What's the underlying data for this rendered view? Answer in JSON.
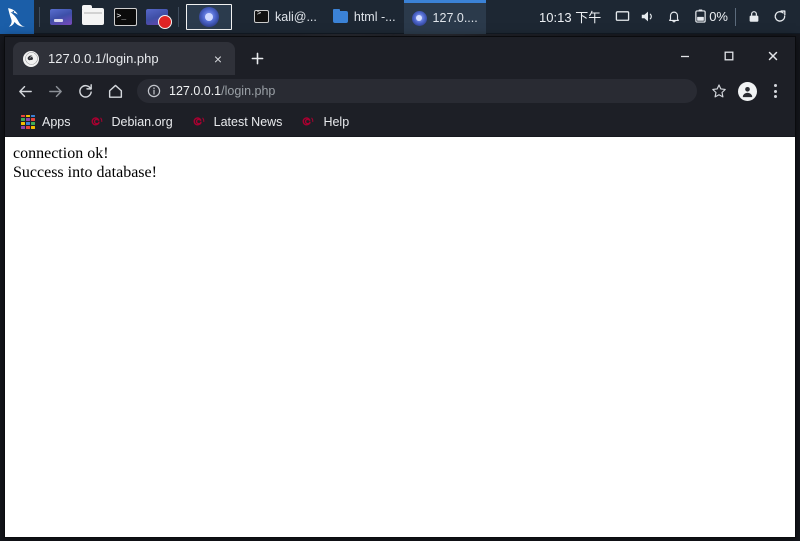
{
  "panel": {
    "logo_icon": "kali-dragon-icon",
    "launchers": [
      {
        "name": "app-launcher-window",
        "icon": "window-app-icon"
      },
      {
        "name": "app-launcher-files",
        "icon": "folder-icon"
      },
      {
        "name": "app-launcher-terminal",
        "icon": "terminal-icon"
      },
      {
        "name": "app-launcher-recorder",
        "icon": "screen-recorder-icon"
      },
      {
        "name": "app-launcher-chromium",
        "icon": "chromium-icon",
        "active": true
      }
    ],
    "tasks": [
      {
        "label": "kali@...",
        "icon": "terminal-icon",
        "active": false
      },
      {
        "label": "html -...",
        "icon": "folder-icon",
        "active": false
      },
      {
        "label": "127.0....",
        "icon": "chromium-icon",
        "active": true
      }
    ],
    "clock": "10:13 下午",
    "tray": {
      "display_icon": "display-icon",
      "volume_icon": "volume-icon",
      "notifications_icon": "bell-icon",
      "battery_icon": "battery-icon",
      "battery_percent": "0%",
      "lock_icon": "lock-icon",
      "power_icon": "power-logout-icon"
    }
  },
  "browser": {
    "tab": {
      "favicon": "globe-swirl-favicon",
      "title": "127.0.0.1/login.php",
      "close_label": "×"
    },
    "new_tab_label": "+",
    "window_controls": {
      "minimize": "–",
      "maximize": "□",
      "close": "✕"
    },
    "toolbar": {
      "back_icon": "back-arrow-icon",
      "forward_icon": "forward-arrow-icon",
      "reload_icon": "reload-icon",
      "home_icon": "home-icon",
      "info_icon": "info-circle-icon",
      "url_host": "127.0.0.1",
      "url_path": "/login.php",
      "url_full": "127.0.0.1/login.php",
      "star_icon": "star-bookmark-icon",
      "profile_icon": "profile-avatar-icon",
      "menu_icon": "three-dot-menu-icon"
    },
    "bookmarks": [
      {
        "label": "Apps",
        "icon": "apps-grid-icon"
      },
      {
        "label": "Debian.org",
        "icon": "debian-swirl-icon"
      },
      {
        "label": "Latest News",
        "icon": "debian-swirl-icon"
      },
      {
        "label": "Help",
        "icon": "debian-swirl-icon"
      }
    ]
  },
  "page": {
    "line1": "connection ok!",
    "line2": "Success into database!"
  },
  "colors": {
    "panel_bg": "#1d2733",
    "chrome_bg": "#1d1f26",
    "tab_active_bg": "#2f3139",
    "omnibox_bg": "#292b33",
    "accent_blue": "#3b82d6",
    "debian_red": "#a80030",
    "page_bg": "#ffffff"
  }
}
